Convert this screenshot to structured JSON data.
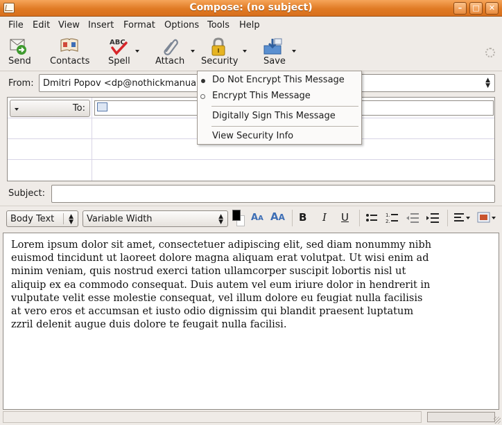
{
  "window": {
    "title": "Compose: (no subject)",
    "minimize_glyph": "–",
    "maximize_glyph": "□",
    "close_glyph": "✕"
  },
  "menubar": {
    "items": [
      "File",
      "Edit",
      "View",
      "Insert",
      "Format",
      "Options",
      "Tools",
      "Help"
    ]
  },
  "toolbar": {
    "send": "Send",
    "contacts": "Contacts",
    "spell": "Spell",
    "spell_glyph": "ABC",
    "attach": "Attach",
    "security": "Security",
    "save": "Save"
  },
  "from": {
    "label": "From:",
    "value": "Dmitri Popov <dp@nothickmanuals"
  },
  "addressing": {
    "to_label": "To:",
    "to_value": ""
  },
  "subject": {
    "label": "Subject:",
    "value": ""
  },
  "formatbar": {
    "paragraph_style": "Body Text",
    "font": "Variable Width",
    "bold": "B",
    "italic": "I",
    "underline": "U",
    "text_color": "#000000",
    "background_color": "#ffffff"
  },
  "security_menu": {
    "items": [
      "Do Not Encrypt This Message",
      "Encrypt This Message",
      "Digitally Sign This Message",
      "View Security Info"
    ],
    "selected": "Do Not Encrypt This Message"
  },
  "body": {
    "lines": [
      "Lorem ipsum dolor sit amet, consectetuer adipiscing elit, sed diam nonummy nibh",
      "euismod tincidunt ut laoreet dolore magna aliquam erat volutpat. Ut wisi enim ad",
      "minim veniam, quis nostrud exerci tation ullamcorper suscipit lobortis nisl ut",
      "aliquip ex ea commodo consequat. Duis autem vel eum iriure dolor in hendrerit in",
      "vulputate velit esse molestie consequat, vel illum dolore eu feugiat nulla facilisis",
      "at vero eros et accumsan et iusto odio dignissim qui blandit praesent luptatum",
      "zzril delenit augue duis dolore te feugait nulla facilisi."
    ]
  },
  "colors": {
    "titlebar": "#e07a24",
    "window_bg": "#efebe7",
    "accent_blue": "#3d6eb5"
  },
  "icons": [
    "send-icon",
    "contacts-icon",
    "spell-check-icon",
    "paperclip-icon",
    "padlock-icon",
    "save-icon",
    "address-card-icon"
  ]
}
